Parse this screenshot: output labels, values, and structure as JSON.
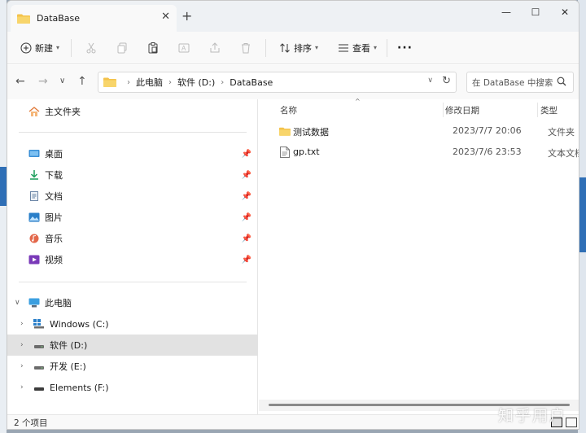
{
  "window": {
    "tab_title": "DataBase"
  },
  "toolbar": {
    "new_label": "新建",
    "sort_label": "排序",
    "view_label": "查看",
    "more_label": "···"
  },
  "address": {
    "crumbs": [
      "此电脑",
      "软件 (D:)",
      "DataBase"
    ],
    "search_placeholder": "在 DataBase 中搜索"
  },
  "sidebar": {
    "home": "主文件夹",
    "quick": [
      {
        "label": "桌面",
        "icon": "desktop-icon"
      },
      {
        "label": "下载",
        "icon": "download-icon"
      },
      {
        "label": "文档",
        "icon": "document-icon"
      },
      {
        "label": "图片",
        "icon": "picture-icon"
      },
      {
        "label": "音乐",
        "icon": "music-icon"
      },
      {
        "label": "视频",
        "icon": "video-icon"
      }
    ],
    "this_pc": "此电脑",
    "drives": [
      {
        "label": "Windows (C:)",
        "selected": false
      },
      {
        "label": "软件 (D:)",
        "selected": true
      },
      {
        "label": "开发 (E:)",
        "selected": false
      },
      {
        "label": "Elements (F:)",
        "selected": false
      }
    ]
  },
  "columns": {
    "name": "名称",
    "modified": "修改日期",
    "type": "类型"
  },
  "files": [
    {
      "name": "测试数据",
      "modified": "2023/7/7 20:06",
      "type": "文件夹",
      "icon": "folder-icon"
    },
    {
      "name": "gp.txt",
      "modified": "2023/7/6 23:53",
      "type": "文本文档",
      "icon": "text-file-icon"
    }
  ],
  "status": {
    "count": "2 个项目"
  },
  "watermark": "知乎用户",
  "colors": {
    "folder": "#f4c24a",
    "accent": "#0067c0",
    "selected_row": "#e2e2e2"
  }
}
